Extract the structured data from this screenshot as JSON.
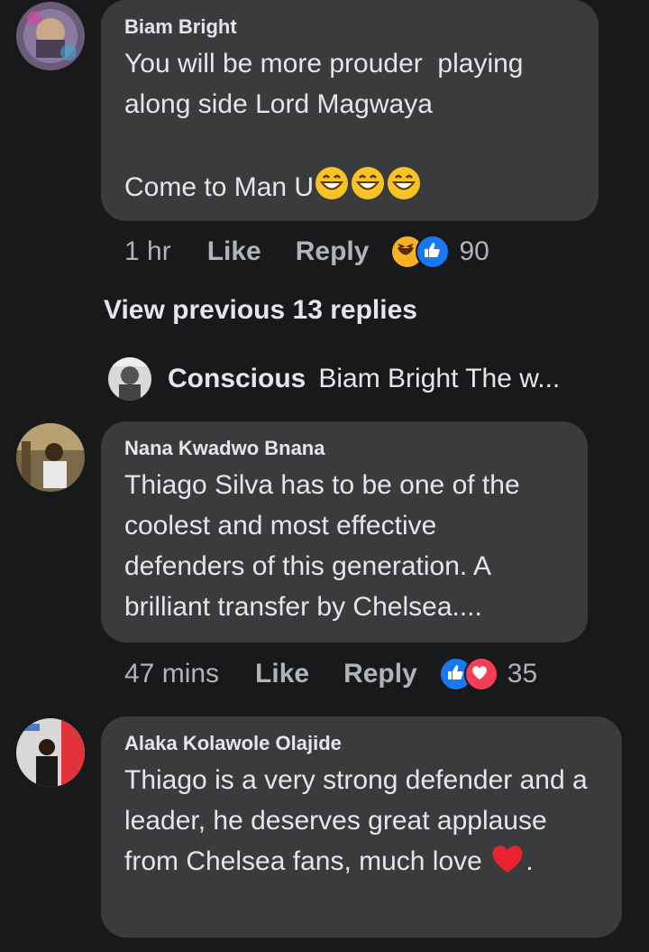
{
  "comments": [
    {
      "author": "Biam Bright",
      "text": "You will be more prouder  playing along side Lord Magwaya\n\nCome to Man U",
      "emoji_suffix": "grinning-face x3",
      "time": "1 hr",
      "like_label": "Like",
      "reply_label": "Reply",
      "reactions": [
        "haha",
        "like"
      ],
      "reaction_count": "90"
    },
    {
      "author": "Nana Kwadwo Bnana",
      "text": "Thiago Silva has to be one of the coolest and most effective defenders of this generation. A brilliant transfer by Chelsea....",
      "time": "47 mins",
      "like_label": "Like",
      "reply_label": "Reply",
      "reactions": [
        "like",
        "love"
      ],
      "reaction_count": "35"
    },
    {
      "author": "Alaka Kolawole Olajide",
      "text": "Thiago is a very strong defender and a leader, he deserves great applause from Chelsea fans, much love",
      "text_suffix": ".",
      "emoji_suffix": "red-heart"
    }
  ],
  "replies_thread": {
    "view_previous": "View previous 13 replies",
    "latest_reply_author": "Conscious",
    "latest_reply_preview": "Biam Bright The w..."
  },
  "colors": {
    "background": "#18191a",
    "bubble": "#3a3b3c",
    "text_primary": "#e4e6eb",
    "text_secondary": "#b0b3b8",
    "like_blue": "#1877f2",
    "love_red": "#f33e58",
    "haha_yellow": "#f7b125"
  }
}
